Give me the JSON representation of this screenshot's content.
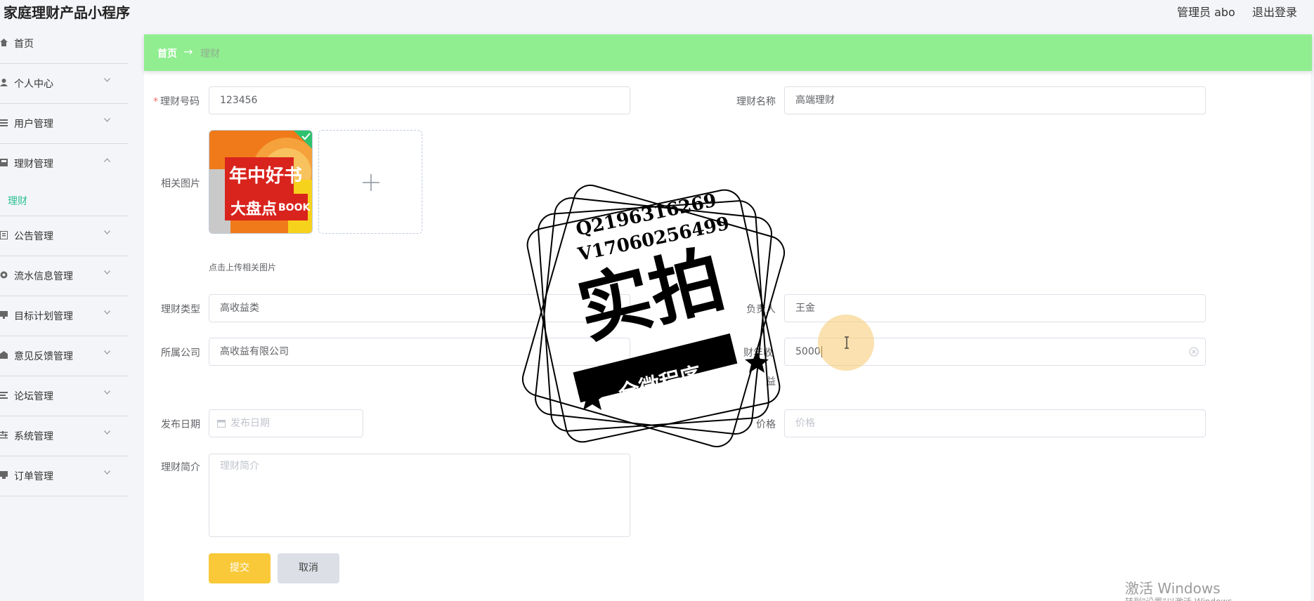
{
  "header": {
    "app_title": "家庭理财产品小程序",
    "user_label": "管理员 abo",
    "logout_label": "退出登录"
  },
  "sidebar": {
    "items": [
      {
        "label": "首页",
        "icon": "home-icon"
      },
      {
        "label": "个人中心",
        "icon": "user-icon"
      },
      {
        "label": "用户管理",
        "icon": "list-icon"
      },
      {
        "label": "理财管理",
        "icon": "finance-icon"
      },
      {
        "label": "公告管理",
        "icon": "notice-icon"
      },
      {
        "label": "流水信息管理",
        "icon": "flow-icon"
      },
      {
        "label": "目标计划管理",
        "icon": "target-icon"
      },
      {
        "label": "意见反馈管理",
        "icon": "feedback-icon"
      },
      {
        "label": "论坛管理",
        "icon": "forum-icon"
      },
      {
        "label": "系统管理",
        "icon": "settings-icon"
      },
      {
        "label": "订单管理",
        "icon": "order-icon"
      }
    ],
    "sub_item": {
      "label": "理财"
    }
  },
  "breadcrumb": {
    "home": "首页",
    "separator": "→",
    "current": "理财"
  },
  "form": {
    "code_label": "理财号码",
    "code_value": "123456",
    "name_label": "理财名称",
    "name_value": "高端理财",
    "image_label": "相关图片",
    "upload_hint": "点击上传相关图片",
    "image_text_1": "年中好书",
    "image_text_2": "大盘点",
    "image_text_3": "BOOK",
    "type_label": "理财类型",
    "type_value": "高收益类",
    "manager_label": "负责人",
    "manager_value": "王金",
    "company_label": "所属公司",
    "company_value": "高收益有限公司",
    "income_label": "财年收",
    "income_label_2": "益",
    "income_value": "5000",
    "date_label": "发布日期",
    "date_placeholder": "发布日期",
    "price_label": "价格",
    "price_placeholder": "价格",
    "intro_label": "理财简介",
    "intro_placeholder": "理财简介",
    "submit_label": "提交",
    "cancel_label": "取消"
  },
  "watermark": {
    "line1": "Q2196316269",
    "line2": "V17060256499",
    "main": "实拍",
    "ribbon": "全微程序"
  },
  "windows": {
    "activate_title": "激活 Windows",
    "activate_sub": "转到\"设置\"以激活 Windows。"
  },
  "colors": {
    "breadcrumb_bg": "#90ee90",
    "submit_bg": "#f9c93a",
    "active_sub": "#2bbf94"
  }
}
